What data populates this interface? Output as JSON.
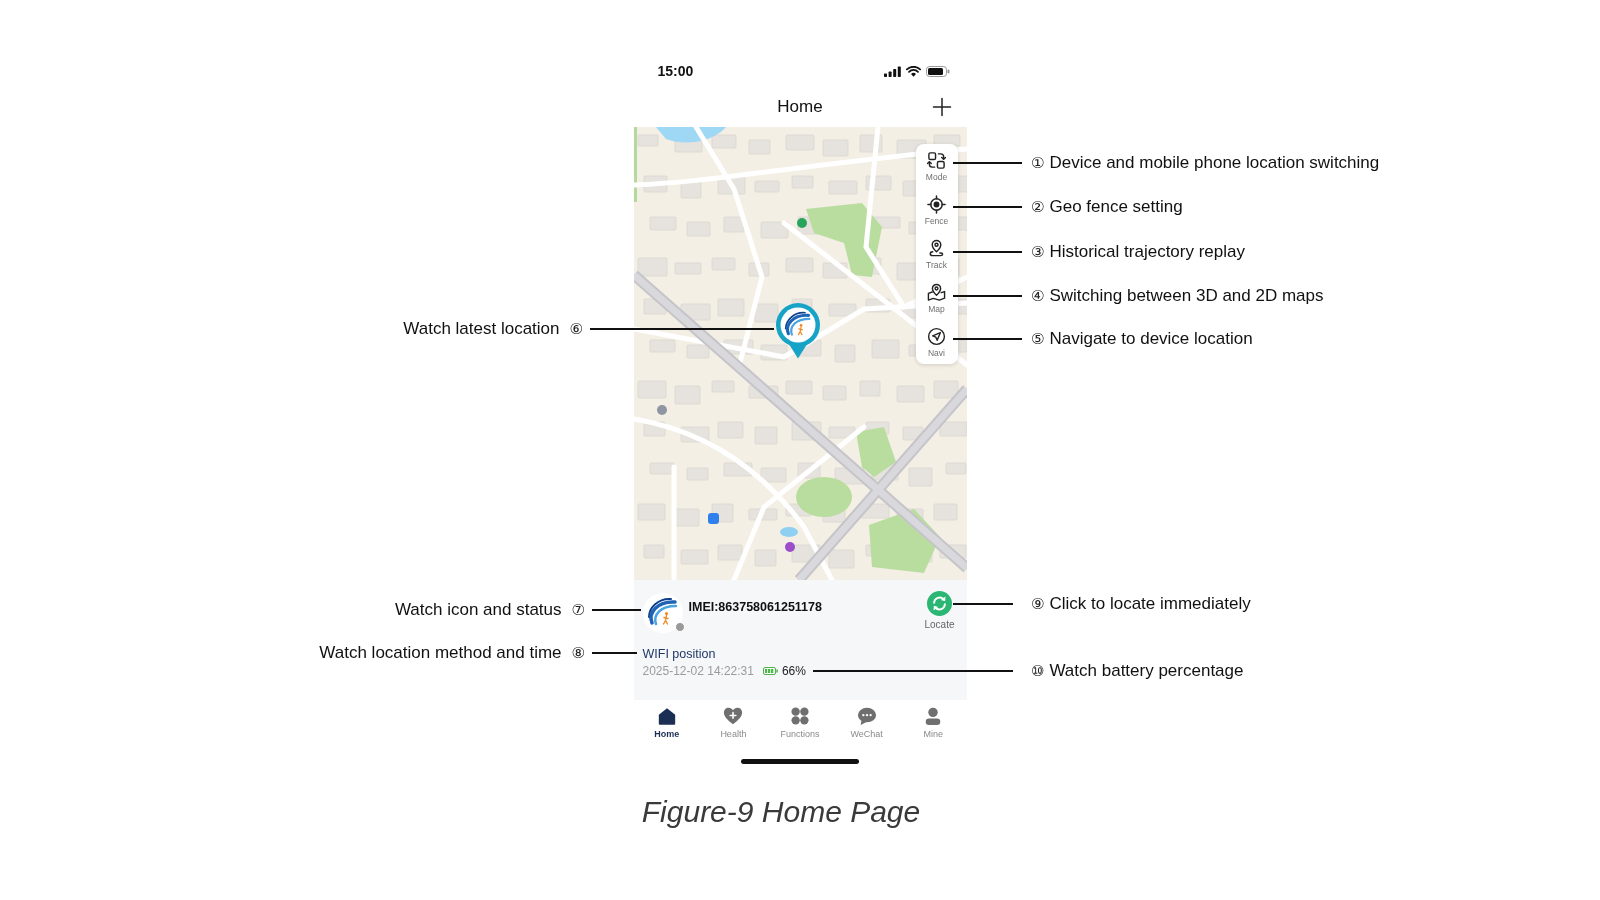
{
  "status_bar": {
    "time": "15:00"
  },
  "nav_bar": {
    "title": "Home"
  },
  "map": {
    "controls": [
      {
        "label": "Mode"
      },
      {
        "label": "Fence"
      },
      {
        "label": "Track"
      },
      {
        "label": "Map"
      },
      {
        "label": "Navi"
      }
    ]
  },
  "device": {
    "imei": "IMEI:863758061251178",
    "online": false,
    "locate_label": "Locate",
    "location_method": "WIFI position",
    "timestamp": "2025-12-02 14:22:31",
    "battery": "66%"
  },
  "tab_bar": [
    {
      "label": "Home",
      "selected": true
    },
    {
      "label": "Health",
      "selected": false
    },
    {
      "label": "Functions",
      "selected": false
    },
    {
      "label": "WeChat",
      "selected": false
    },
    {
      "label": "Mine",
      "selected": false
    }
  ],
  "callouts": [
    {
      "number": "①",
      "text": "Device and mobile phone location switching"
    },
    {
      "number": "②",
      "text": "Geo fence setting"
    },
    {
      "number": "③",
      "text": "Historical trajectory replay"
    },
    {
      "number": "④",
      "text": "Switching between 3D and 2D maps"
    },
    {
      "number": "⑤",
      "text": "Navigate to device location"
    },
    {
      "number": "⑥",
      "text": "Watch latest location"
    },
    {
      "number": "⑦",
      "text": "Watch icon and status"
    },
    {
      "number": "⑧",
      "text": "Watch location method and time"
    },
    {
      "number": "⑨",
      "text": "Click to locate immediately"
    },
    {
      "number": "⑩",
      "text": "Watch battery percentage"
    }
  ],
  "caption": "Figure-9 Home Page"
}
